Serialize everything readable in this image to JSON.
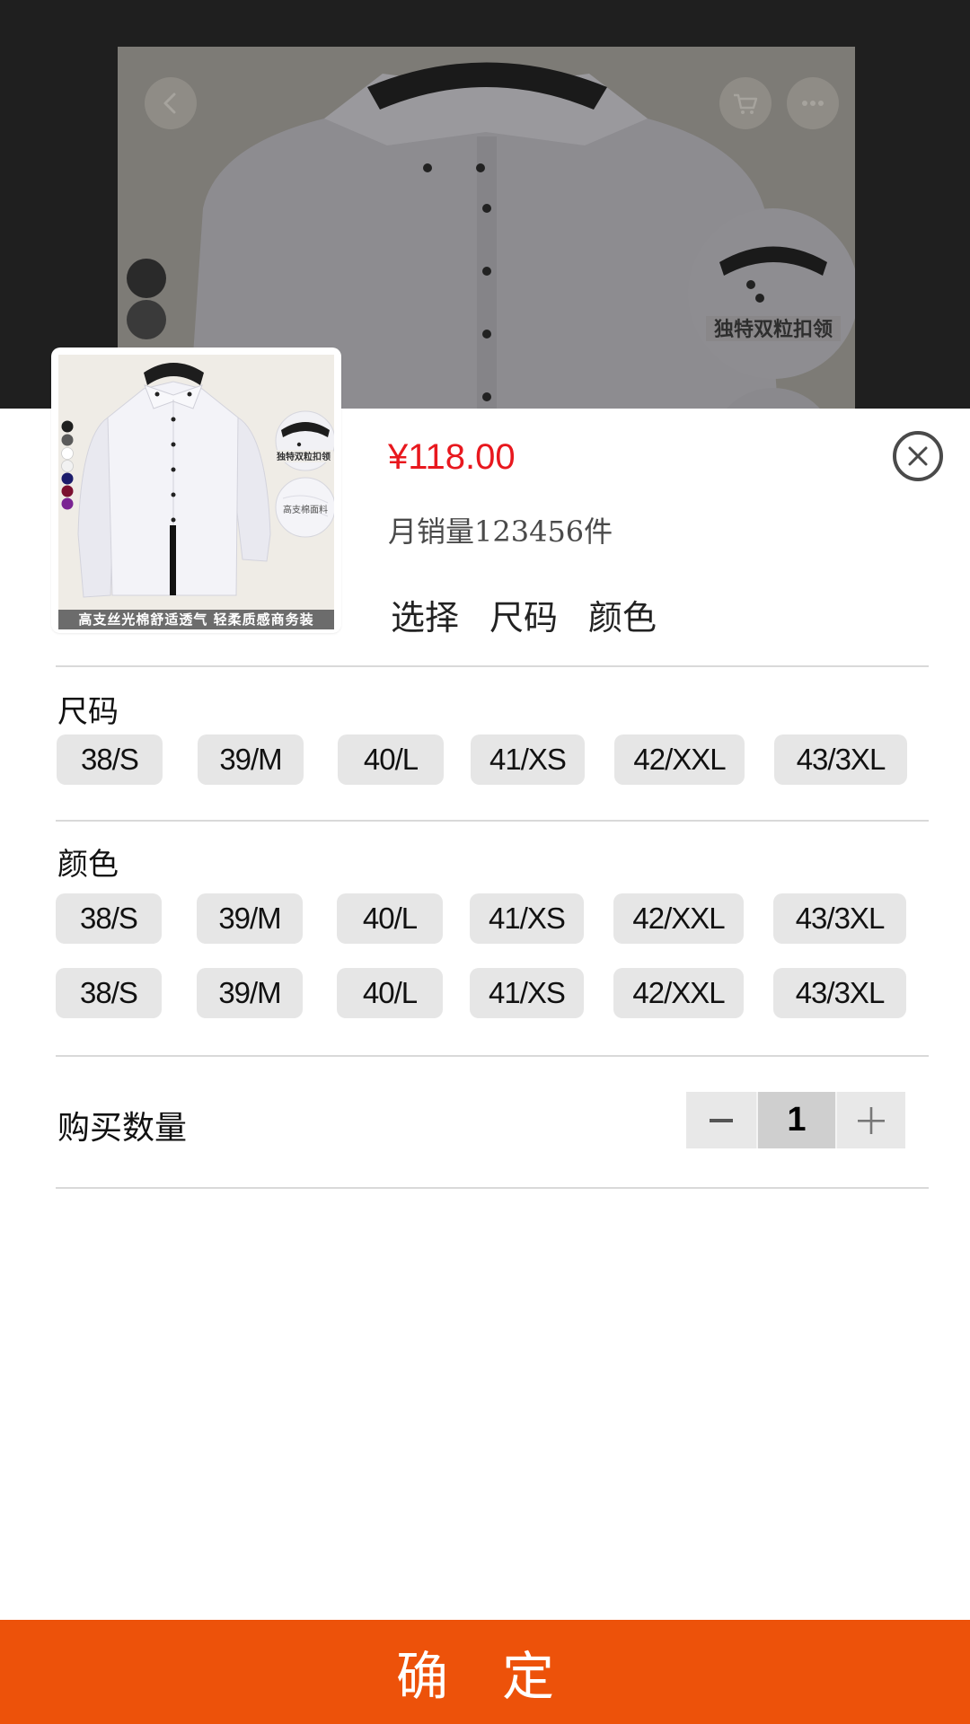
{
  "background": {
    "photo_caption": "独特双粒扣领",
    "back_icon": "chevron-left-icon",
    "cart_icon": "cart-icon",
    "more_icon": "more-dots-icon"
  },
  "product": {
    "price": "¥118.00",
    "sales": "月销量123456件",
    "selection": {
      "prefix": "选择",
      "size": "尺码",
      "color": "颜色"
    },
    "thumbnail": {
      "caption": "高支丝光棉舒适透气 轻柔质感商务装",
      "badge_top": "独特双粒扣领",
      "badge_bottom": "高支棉面料"
    }
  },
  "size_section": {
    "label": "尺码",
    "options": [
      "38/S",
      "39/M",
      "40/L",
      "41/XS",
      "42/XXL",
      "43/3XL"
    ]
  },
  "color_section": {
    "label": "颜色",
    "rows": [
      [
        "38/S",
        "39/M",
        "40/L",
        "41/XS",
        "42/XXL",
        "43/3XL"
      ],
      [
        "38/S",
        "39/M",
        "40/L",
        "41/XS",
        "42/XXL",
        "43/3XL"
      ]
    ]
  },
  "quantity": {
    "label": "购买数量",
    "value": "1",
    "minus_icon": "minus-icon",
    "plus_icon": "plus-icon"
  },
  "close_icon": "close-circle-icon",
  "confirm_label": "确 定",
  "colors": {
    "price": "#e8181e",
    "confirm_bg": "#ed520a",
    "chip_bg": "#e6e6e6"
  }
}
